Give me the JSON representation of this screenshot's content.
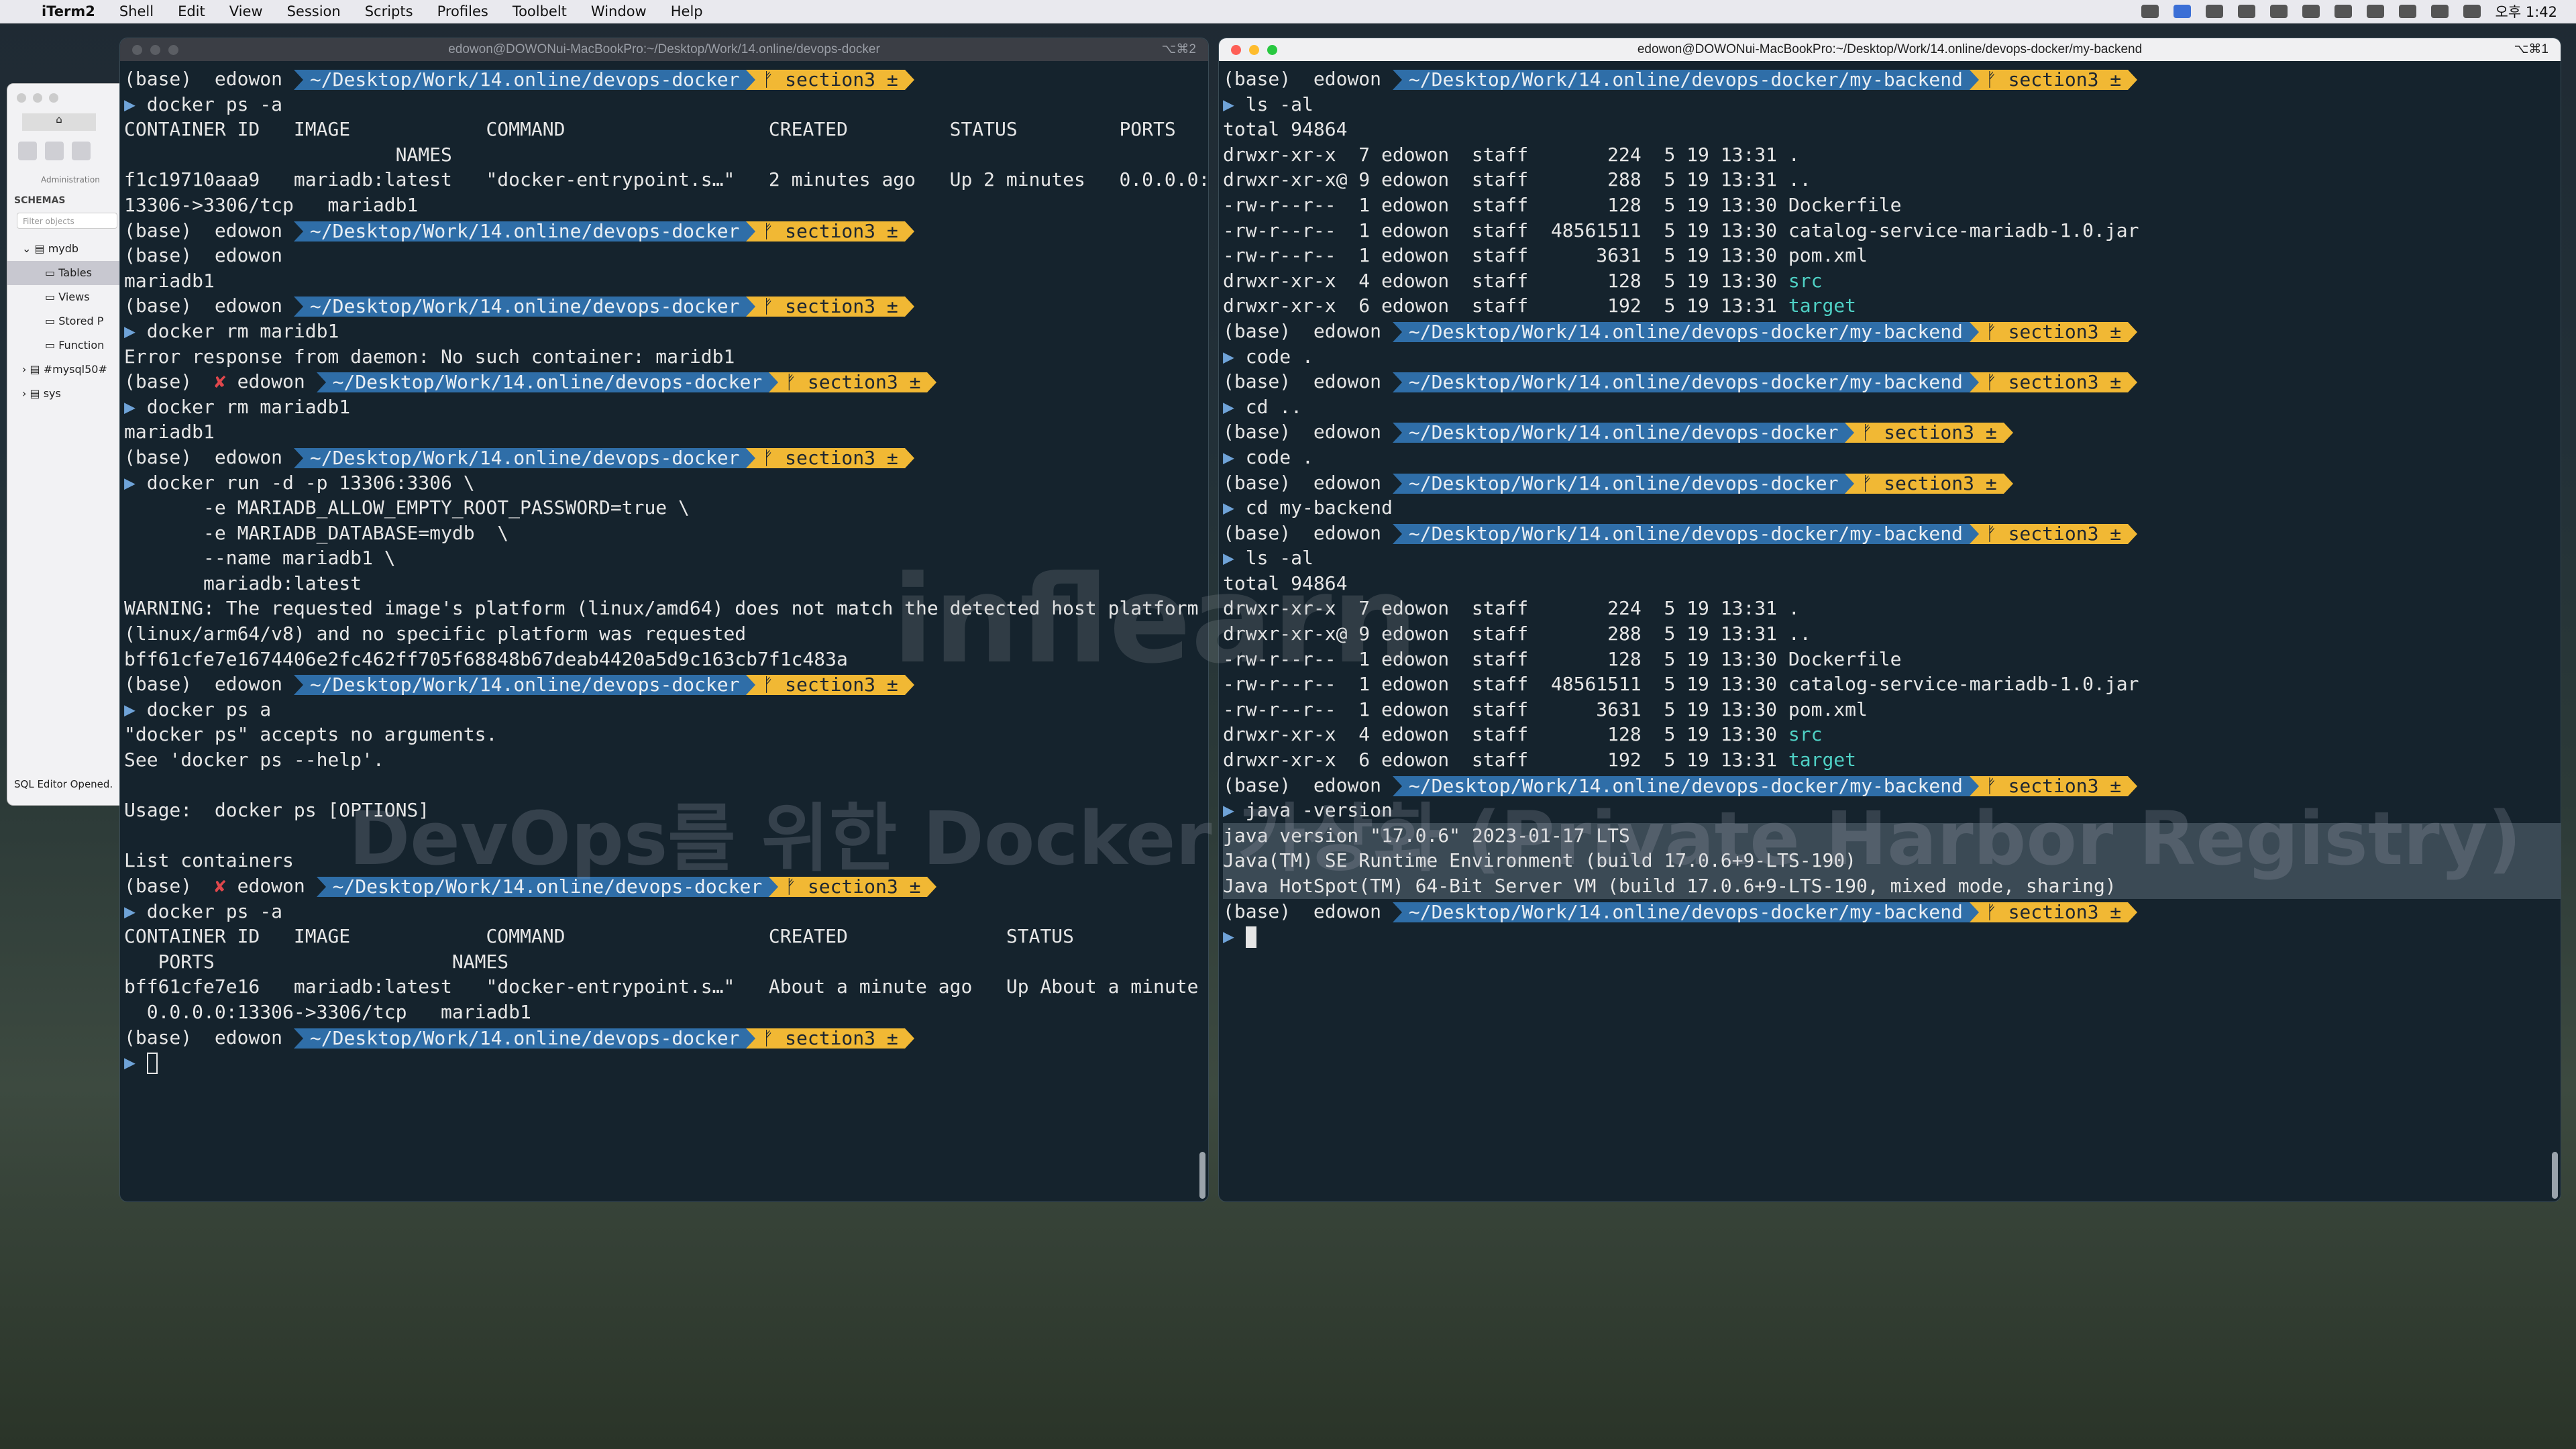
{
  "menubar": {
    "app": "iTerm2",
    "items": [
      "Shell",
      "Edit",
      "View",
      "Session",
      "Scripts",
      "Profiles",
      "Toolbelt",
      "Window",
      "Help"
    ],
    "clock": "오후 1:42"
  },
  "workbench": {
    "admin_label": "Administration",
    "schemas_label": "SCHEMAS",
    "filter_placeholder": "Filter objects",
    "tree": [
      "mydb",
      "Tables",
      "Views",
      "Stored P",
      "Function",
      "#mysql50#",
      "sys"
    ],
    "status": "SQL Editor Opened."
  },
  "left_term": {
    "title": "edowon@DOWONui-MacBookPro:~/Desktop/Work/14.online/devops-docker",
    "shortcut": "⌥⌘2",
    "lines": [
      {
        "prompt": {
          "x": false,
          "path": "~/Desktop/Work/14.online/devops-docker",
          "branch": "ᚠ section3 ±"
        }
      },
      {
        "cmd": "docker ps -a"
      },
      {
        "text": "CONTAINER ID   IMAGE            COMMAND                  CREATED         STATUS         PORTS"
      },
      {
        "text": "                        NAMES"
      },
      {
        "text": "f1c19710aaa9   mariadb:latest   \"docker-entrypoint.s…\"   2 minutes ago   Up 2 minutes   0.0.0.0:"
      },
      {
        "text": "13306->3306/tcp   mariadb1"
      },
      {
        "prompt": {
          "x": false,
          "path": "~/Desktop/Work/14.online/devops-docker",
          "branch": "ᚠ section3 ±"
        }
      },
      {
        "text": "(base)  edowon "
      },
      {
        "text": "mariadb1"
      },
      {
        "prompt": {
          "x": false,
          "path": "~/Desktop/Work/14.online/devops-docker",
          "branch": "ᚠ section3 ±"
        }
      },
      {
        "cmd": "docker rm maridb1"
      },
      {
        "text": "Error response from daemon: No such container: maridb1"
      },
      {
        "prompt": {
          "x": true,
          "path": "~/Desktop/Work/14.online/devops-docker",
          "branch": "ᚠ section3 ±"
        }
      },
      {
        "cmd": "docker rm mariadb1"
      },
      {
        "text": "mariadb1"
      },
      {
        "prompt": {
          "x": false,
          "path": "~/Desktop/Work/14.online/devops-docker",
          "branch": "ᚠ section3 ±"
        }
      },
      {
        "cmd": "docker run -d -p 13306:3306 \\"
      },
      {
        "text": "       -e MARIADB_ALLOW_EMPTY_ROOT_PASSWORD=true \\"
      },
      {
        "text": "       -e MARIADB_DATABASE=mydb  \\"
      },
      {
        "text": "       --name mariadb1 \\"
      },
      {
        "text": "       mariadb:latest"
      },
      {
        "text": "WARNING: The requested image's platform (linux/amd64) does not match the detected host platform"
      },
      {
        "text": "(linux/arm64/v8) and no specific platform was requested"
      },
      {
        "text": "bff61cfe7e1674406e2fc462ff705f68848b67deab4420a5d9c163cb7f1c483a"
      },
      {
        "prompt": {
          "x": false,
          "path": "~/Desktop/Work/14.online/devops-docker",
          "branch": "ᚠ section3 ±"
        }
      },
      {
        "cmd": "docker ps a"
      },
      {
        "text": "\"docker ps\" accepts no arguments."
      },
      {
        "text": "See 'docker ps --help'."
      },
      {
        "text": ""
      },
      {
        "text": "Usage:  docker ps [OPTIONS]"
      },
      {
        "text": ""
      },
      {
        "text": "List containers"
      },
      {
        "prompt": {
          "x": true,
          "path": "~/Desktop/Work/14.online/devops-docker",
          "branch": "ᚠ section3 ±"
        }
      },
      {
        "cmd": "docker ps -a"
      },
      {
        "text": "CONTAINER ID   IMAGE            COMMAND                  CREATED              STATUS"
      },
      {
        "text": "   PORTS                     NAMES"
      },
      {
        "text": "bff61cfe7e16   mariadb:latest   \"docker-entrypoint.s…\"   About a minute ago   Up About a minute"
      },
      {
        "text": "  0.0.0.0:13306->3306/tcp   mariadb1"
      },
      {
        "prompt": {
          "x": false,
          "path": "~/Desktop/Work/14.online/devops-docker",
          "branch": "ᚠ section3 ±"
        }
      },
      {
        "cursor": "hollow"
      }
    ]
  },
  "right_term": {
    "title": "edowon@DOWONui-MacBookPro:~/Desktop/Work/14.online/devops-docker/my-backend",
    "shortcut": "⌥⌘1",
    "lines": [
      {
        "prompt": {
          "x": false,
          "path": "~/Desktop/Work/14.online/devops-docker/my-backend",
          "branch": "ᚠ section3 ±"
        }
      },
      {
        "cmd": "ls -al"
      },
      {
        "text": "total 94864"
      },
      {
        "text": "drwxr-xr-x  7 edowon  staff       224  5 19 13:31 ."
      },
      {
        "text": "drwxr-xr-x@ 9 edowon  staff       288  5 19 13:31 .."
      },
      {
        "text": "-rw-r--r--  1 edowon  staff       128  5 19 13:30 Dockerfile"
      },
      {
        "text": "-rw-r--r--  1 edowon  staff  48561511  5 19 13:30 catalog-service-mariadb-1.0.jar"
      },
      {
        "text": "-rw-r--r--  1 edowon  staff      3631  5 19 13:30 pom.xml"
      },
      {
        "text": "drwxr-xr-x  4 edowon  staff       128  5 19 13:30 ",
        "teal": "src"
      },
      {
        "text": "drwxr-xr-x  6 edowon  staff       192  5 19 13:31 ",
        "teal": "target"
      },
      {
        "prompt": {
          "x": false,
          "path": "~/Desktop/Work/14.online/devops-docker/my-backend",
          "branch": "ᚠ section3 ±"
        }
      },
      {
        "cmd": "code ."
      },
      {
        "prompt": {
          "x": false,
          "path": "~/Desktop/Work/14.online/devops-docker/my-backend",
          "branch": "ᚠ section3 ±"
        }
      },
      {
        "cmd": "cd .."
      },
      {
        "prompt": {
          "x": false,
          "path": "~/Desktop/Work/14.online/devops-docker",
          "branch": "ᚠ section3 ±"
        }
      },
      {
        "cmd": "code ."
      },
      {
        "prompt": {
          "x": false,
          "path": "~/Desktop/Work/14.online/devops-docker",
          "branch": "ᚠ section3 ±"
        }
      },
      {
        "cmd": "cd my-backend"
      },
      {
        "prompt": {
          "x": false,
          "path": "~/Desktop/Work/14.online/devops-docker/my-backend",
          "branch": "ᚠ section3 ±"
        }
      },
      {
        "cmd": "ls -al"
      },
      {
        "text": "total 94864"
      },
      {
        "text": "drwxr-xr-x  7 edowon  staff       224  5 19 13:31 ."
      },
      {
        "text": "drwxr-xr-x@ 9 edowon  staff       288  5 19 13:31 .."
      },
      {
        "text": "-rw-r--r--  1 edowon  staff       128  5 19 13:30 Dockerfile"
      },
      {
        "text": "-rw-r--r--  1 edowon  staff  48561511  5 19 13:30 catalog-service-mariadb-1.0.jar"
      },
      {
        "text": "-rw-r--r--  1 edowon  staff      3631  5 19 13:30 pom.xml"
      },
      {
        "text": "drwxr-xr-x  4 edowon  staff       128  5 19 13:30 ",
        "teal": "src"
      },
      {
        "text": "drwxr-xr-x  6 edowon  staff       192  5 19 13:31 ",
        "teal": "target"
      },
      {
        "prompt": {
          "x": false,
          "path": "~/Desktop/Work/14.online/devops-docker/my-backend",
          "branch": "ᚠ section3 ±"
        }
      },
      {
        "cmd": "java -version"
      },
      {
        "text": "java version \"17.0.6\" 2023-01-17 LTS",
        "hl": true
      },
      {
        "text": "Java(TM) SE Runtime Environment (build 17.0.6+9-LTS-190)",
        "hl": true
      },
      {
        "text": "Java HotSpot(TM) 64-Bit Server VM (build 17.0.6+9-LTS-190, mixed mode, sharing)",
        "hl": true
      },
      {
        "prompt": {
          "x": false,
          "path": "~/Desktop/Work/14.online/devops-docker/my-backend",
          "branch": "ᚠ section3 ±"
        }
      },
      {
        "cursor": "solid"
      }
    ]
  },
  "watermark": {
    "line1": "DevOps를 위한 Docker 가상화 (Private Harbor Registry)",
    "line2": "inflearn"
  },
  "prompt_base": "(base)",
  "prompt_user": "edowon"
}
